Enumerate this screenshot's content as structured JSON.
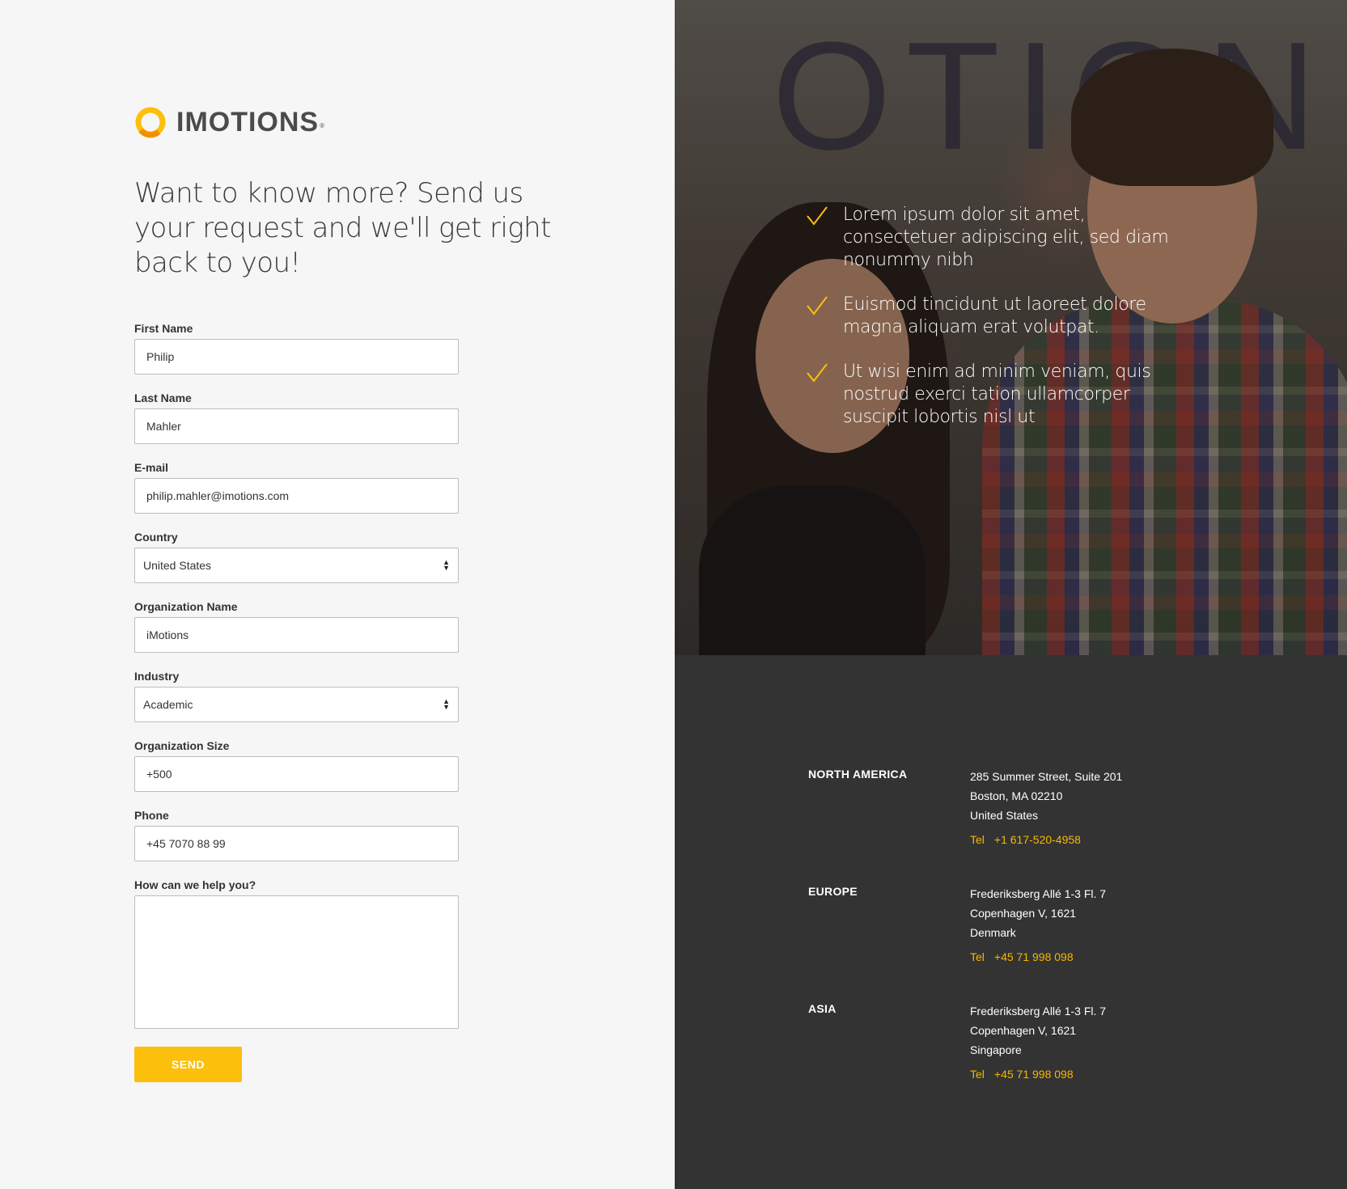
{
  "brand": {
    "name": "IMOTIONS",
    "registered": "®",
    "accent_color": "#fcbf0c"
  },
  "headline": "Want to know more? Send us your request and we'll get right back to you!",
  "form": {
    "first_name": {
      "label": "First Name",
      "value": "Philip"
    },
    "last_name": {
      "label": "Last Name",
      "value": "Mahler"
    },
    "email": {
      "label": "E-mail",
      "value": "philip.mahler@imotions.com"
    },
    "country": {
      "label": "Country",
      "value": "United States"
    },
    "organization_name": {
      "label": "Organization Name",
      "value": "iMotions"
    },
    "industry": {
      "label": "Industry",
      "value": "Academic"
    },
    "organization_size": {
      "label": "Organization Size",
      "value": "+500"
    },
    "phone": {
      "label": "Phone",
      "value": "+45 7070 88 99"
    },
    "message": {
      "label": "How can we help you?",
      "value": ""
    },
    "send_label": "SEND"
  },
  "hero": {
    "background_text": "OTION",
    "benefits": [
      "Lorem ipsum dolor sit amet, consectetuer adipiscing elit, sed diam nonummy nibh",
      "Euismod tincidunt ut laoreet dolore magna aliquam erat volutpat.",
      "Ut wisi enim ad minim veniam, quis nostrud exerci tation ullamcorper suscipit lobortis nisl ut"
    ],
    "check_icon": "checkmark-icon"
  },
  "offices": [
    {
      "region": "NORTH AMERICA",
      "address": [
        "285 Summer Street, Suite 201",
        "Boston, MA 02210",
        "United States"
      ],
      "tel_label": "Tel",
      "tel": "+1 617-520-4958"
    },
    {
      "region": "EUROPE",
      "address": [
        "Frederiksberg Allé 1-3 Fl. 7",
        "Copenhagen V, 1621",
        "Denmark"
      ],
      "tel_label": "Tel",
      "tel": "+45 71 998 098"
    },
    {
      "region": "ASIA",
      "address": [
        "Frederiksberg Allé 1-3 Fl. 7",
        "Copenhagen V, 1621",
        "Singapore"
      ],
      "tel_label": "Tel",
      "tel": "+45 71 998 098"
    }
  ]
}
